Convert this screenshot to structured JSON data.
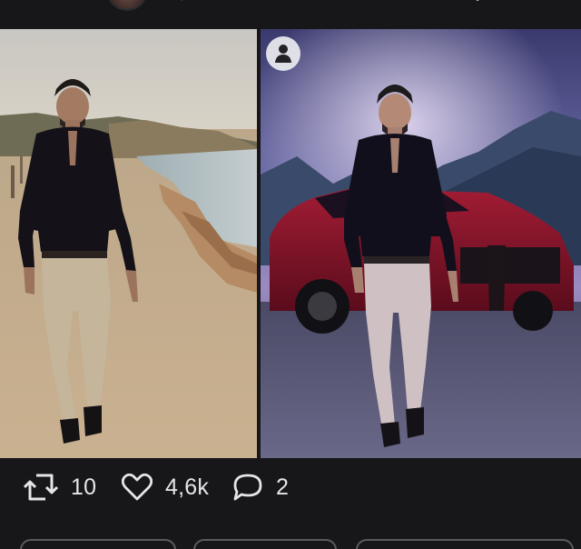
{
  "post": {
    "actions": {
      "retweet_count": "10",
      "like_count": "4,6k",
      "reply_count": "2"
    }
  },
  "icons": {
    "retweet": "retweet-icon",
    "like": "heart-icon",
    "reply": "comment-icon",
    "user_badge": "person-icon"
  },
  "colors": {
    "background": "#17171a",
    "text": "#e6e6e8",
    "icon": "#e6e6e8"
  }
}
